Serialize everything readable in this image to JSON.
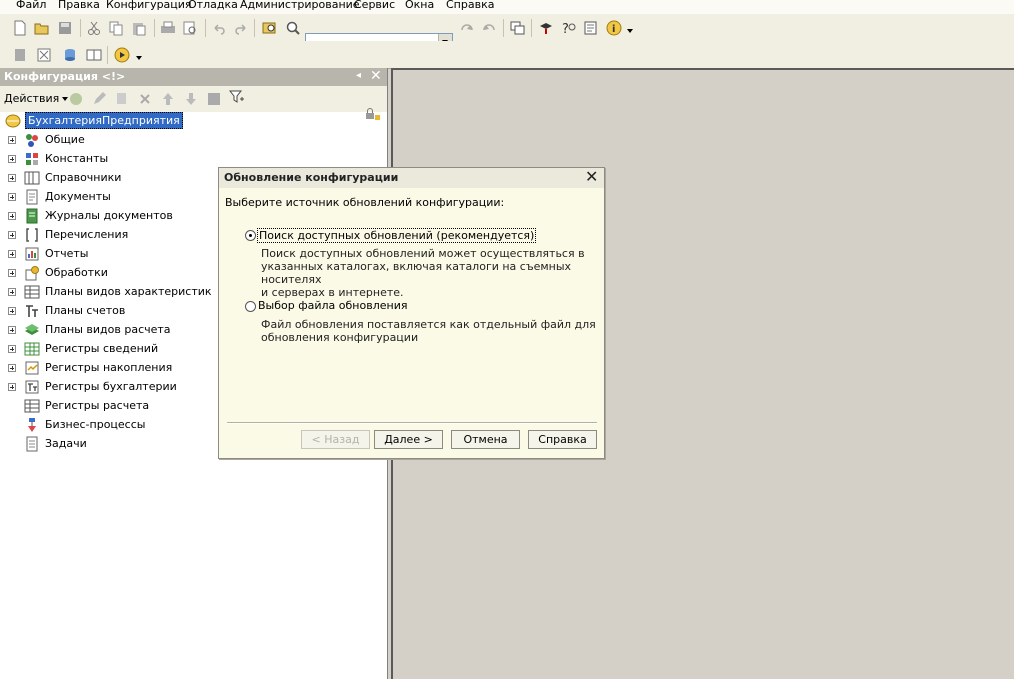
{
  "menu": [
    "Файл",
    "Правка",
    "Конфигурация",
    "Отладка",
    "Администрирование",
    "Сервис",
    "Окна",
    "Справка"
  ],
  "toolbar": {
    "search_value": ""
  },
  "colors": {
    "selection": "#316ac5",
    "panel_title": "#b8b6ac",
    "workspace": "#d4d0c8"
  },
  "panel": {
    "title": "Конфигурация <!>",
    "actions_label": "Действия",
    "root": "БухгалтерияПредприятия",
    "items": [
      {
        "label": "Общие",
        "icon": "common-icon",
        "expandable": true
      },
      {
        "label": "Константы",
        "icon": "constants-icon",
        "expandable": true
      },
      {
        "label": "Справочники",
        "icon": "catalogs-icon",
        "expandable": true
      },
      {
        "label": "Документы",
        "icon": "documents-icon",
        "expandable": true
      },
      {
        "label": "Журналы документов",
        "icon": "journals-icon",
        "expandable": true
      },
      {
        "label": "Перечисления",
        "icon": "enums-icon",
        "expandable": true
      },
      {
        "label": "Отчеты",
        "icon": "reports-icon",
        "expandable": true
      },
      {
        "label": "Обработки",
        "icon": "processing-icon",
        "expandable": true
      },
      {
        "label": "Планы видов характеристик",
        "icon": "characteristic-plans-icon",
        "expandable": true
      },
      {
        "label": "Планы счетов",
        "icon": "charts-of-accounts-icon",
        "expandable": true
      },
      {
        "label": "Планы видов расчета",
        "icon": "calc-plans-icon",
        "expandable": true
      },
      {
        "label": "Регистры сведений",
        "icon": "info-registers-icon",
        "expandable": true
      },
      {
        "label": "Регистры накопления",
        "icon": "accum-registers-icon",
        "expandable": true
      },
      {
        "label": "Регистры бухгалтерии",
        "icon": "accounting-registers-icon",
        "expandable": true
      },
      {
        "label": "Регистры расчета",
        "icon": "calc-registers-icon",
        "expandable": false
      },
      {
        "label": "Бизнес-процессы",
        "icon": "business-processes-icon",
        "expandable": false
      },
      {
        "label": "Задачи",
        "icon": "tasks-icon",
        "expandable": false
      }
    ]
  },
  "dialog": {
    "title": "Обновление конфигурации",
    "prompt": "Выберите источник обновлений конфигурации:",
    "option1": {
      "label": "Поиск доступных обновлений (рекомендуется)",
      "selected": true,
      "desc": [
        "Поиск доступных обновлений может осуществляться в",
        "указанных каталогах, включая каталоги на съемных носителях",
        "и серверах в интернете."
      ]
    },
    "option2": {
      "label": "Выбор файла обновления",
      "selected": false,
      "desc": [
        "Файл обновления поставляется как отдельный файл для",
        "обновления конфигурации"
      ]
    },
    "buttons": {
      "back": "< Назад",
      "next": "Далее >",
      "cancel": "Отмена",
      "help": "Справка"
    }
  }
}
